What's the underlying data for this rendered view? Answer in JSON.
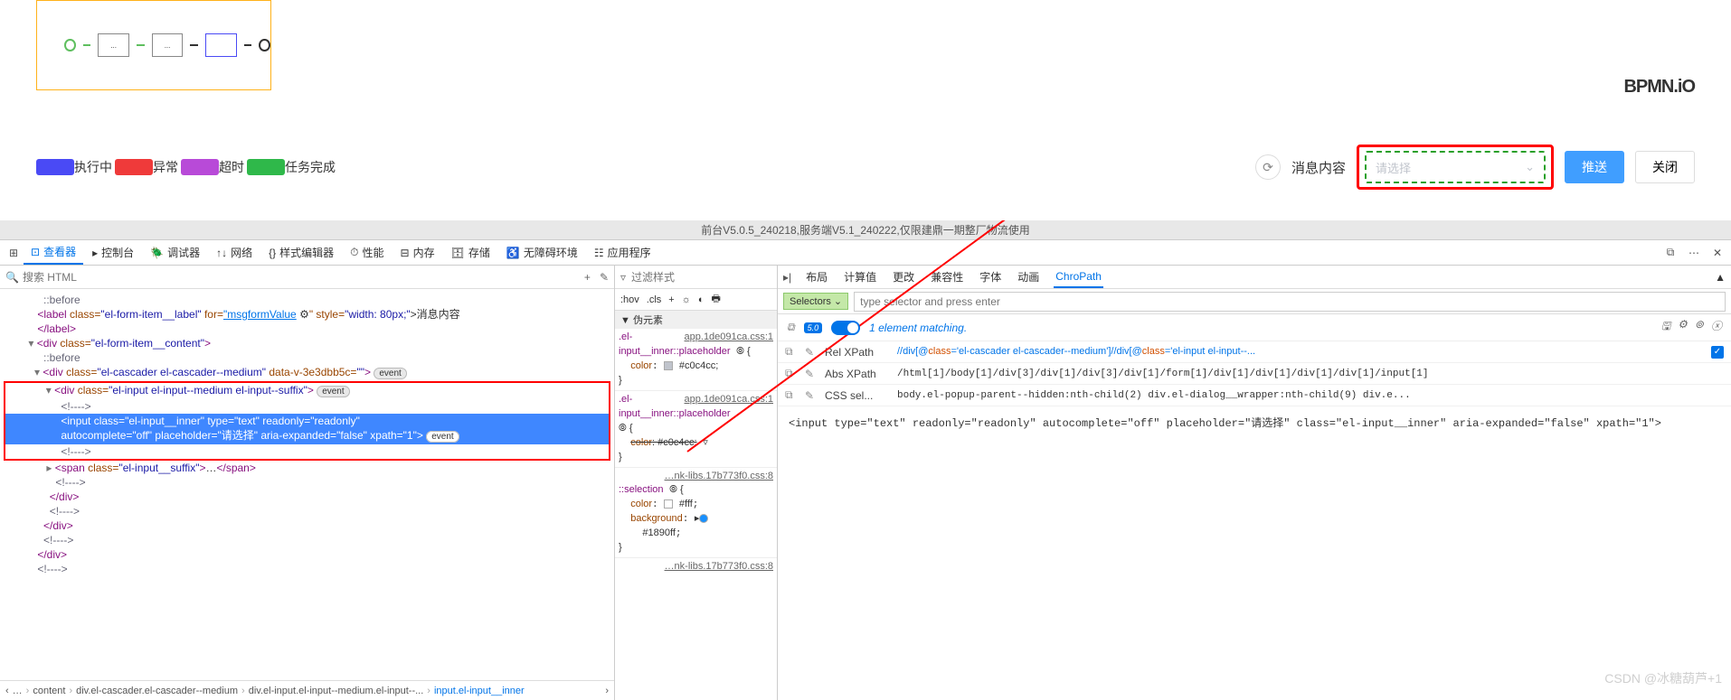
{
  "app": {
    "bpmn_logo": "BPMN.iO",
    "legend": [
      {
        "color": "#4a4af5",
        "label": "执行中"
      },
      {
        "color": "#ef3a3a",
        "label": "异常"
      },
      {
        "color": "#b84ad8",
        "label": "超时"
      },
      {
        "color": "#2fb84a",
        "label": "任务完成"
      }
    ],
    "msg_label": "消息内容",
    "cascader_placeholder": "请选择",
    "push_btn": "推送",
    "close_btn": "关闭",
    "version": "前台V5.0.5_240218,服务端V5.1_240222,仅限建鼎一期整厂物流使用"
  },
  "devtools": {
    "tabs": [
      "查看器",
      "控制台",
      "调试器",
      "网络",
      "样式编辑器",
      "性能",
      "内存",
      "存储",
      "无障碍环境",
      "应用程序"
    ],
    "active_tab": "查看器",
    "dom_search_placeholder": "搜索 HTML",
    "dom": {
      "l1": "::before",
      "l2a": "<label ",
      "l2_cls": "class=",
      "l2_clsv": "\"el-form-item__label\"",
      "l2_for": " for=",
      "l2_forv": "\"msgformValue",
      "l2_style": "\" style=",
      "l2_stylev": "\"width: 80px;\"",
      "l2_txt": ">消息内容",
      "l3": "</label>",
      "l4": "<div ",
      "l4_cls": "class=",
      "l4_clsv": "\"el-form-item__content\"",
      "l4_end": ">",
      "l5": "::before",
      "l6": "<div ",
      "l6_cls": "class=",
      "l6_clsv": "\"el-cascader el-cascader--medium\"",
      "l6_dv": " data-v-3e3dbb5c=",
      "l6_dvv": "\"\"",
      "l6_end": ">",
      "l7": "<div ",
      "l7_cls": "class=",
      "l7_clsv": "\"el-input el-input--medium el-input--suffix\"",
      "l7_end": ">",
      "l8": "<!---->",
      "l9": "<input ",
      "l9_cls": "class=",
      "l9_clsv": "\"el-input__inner\"",
      "l9_t": " type=",
      "l9_tv": "\"text\"",
      "l9_ro": " readonly=",
      "l9_rov": "\"readonly\"",
      "l10_ac": "autocomplete=",
      "l10_acv": "\"off\"",
      "l10_ph": " placeholder=",
      "l10_phv": "\"请选择\"",
      "l10_ae": " aria-expanded=",
      "l10_aev": "\"false\"",
      "l10_xp": " xpath=",
      "l10_xpv": "\"1\"",
      "l10_end": ">",
      "l11": "<!---->",
      "l12": "<span ",
      "l12_cls": "class=",
      "l12_clsv": "\"el-input__suffix\"",
      "l12_mid": ">",
      "l12_dots": "…",
      "l12_end": "</span>",
      "l13": "<!---->",
      "l14": "</div>",
      "l15": "<!---->",
      "l16": "</div>",
      "l17": "<!---->",
      "l18": "</div>",
      "l19": "<!---->",
      "event": "event"
    },
    "crumbs": [
      "…",
      "content",
      "div.el-cascader.el-cascader--medium",
      "div.el-input.el-input--medium.el-input--...",
      "input.el-input__inner"
    ],
    "styles": {
      "filter_placeholder": "过滤样式",
      "hov": ":hov",
      "cls": ".cls",
      "pseudo_header": "▼ 伪元素",
      "file1": "app.1de091ca.css:1",
      "sel1a": ".el-",
      "sel1b": "input__inner::placeholder",
      "brace_o": " {",
      "prop_color": "color",
      "val_color": "#c0c4cc",
      "semi": ";",
      "brace_c": "}",
      "file2": "…nk-libs.17b773f0.css:8",
      "sel3": "::selection",
      "sel3_brace": " {",
      "val_fff": "#fff",
      "prop_bg": "background",
      "val_1890": "#1890ff",
      "file3": "…nk-libs.17b773f0.css:8"
    },
    "right": {
      "tabs": [
        "布局",
        "计算值",
        "更改",
        "兼容性",
        "字体",
        "动画",
        "ChroPath"
      ],
      "active": "ChroPath",
      "selectors": "Selectors ⌄",
      "input_placeholder": "type selector and press enter",
      "badge": "5.0",
      "match": "1 element matching.",
      "rows": [
        {
          "label": "Rel XPath",
          "val_p1": "//div[@",
          "val_p2": "class",
          "val_p3": "='el-cascader el-cascader--medium'",
          "val_p4": "]//div[@",
          "val_p5": "class",
          "val_p6": "='el-input el-input--...",
          "chk": true
        },
        {
          "label": "Abs XPath",
          "plain": "/html[1]/body[1]/div[3]/div[1]/div[3]/div[1]/form[1]/div[1]/div[1]/div[1]/div[1]/input[1]"
        },
        {
          "label": "CSS sel...",
          "plain": "body.el-popup-parent--hidden:nth-child(2) div.el-dialog__wrapper:nth-child(9) div.e..."
        }
      ],
      "snippet": "<input type=\"text\" readonly=\"readonly\" autocomplete=\"off\" placeholder=\"请选择\" class=\"el-input__inner\" aria-expanded=\"false\" xpath=\"1\">"
    }
  },
  "watermark": "CSDN @冰糖葫芦+1"
}
